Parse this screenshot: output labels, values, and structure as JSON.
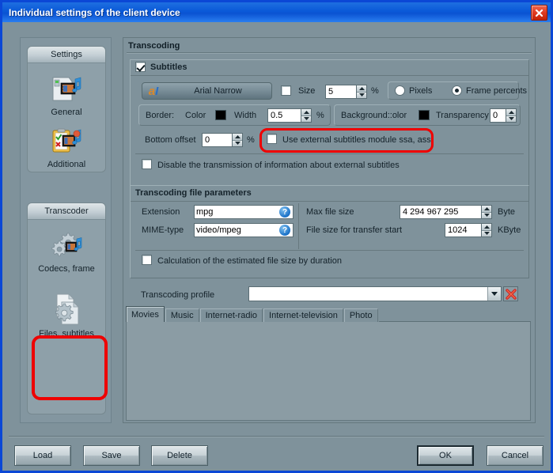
{
  "window": {
    "title": "Individual settings of the client device",
    "close_label": "×",
    "titlebar_color": "#0a59d8",
    "body_color": "#7f929b"
  },
  "sidebar": {
    "groups": [
      {
        "header": "Settings",
        "items": [
          {
            "label": "General",
            "icon": "folder-media-icon"
          },
          {
            "label": "Additional",
            "icon": "checklist-media-icon"
          }
        ]
      },
      {
        "header": "Transcoder",
        "items": [
          {
            "label": "Codecs, frame",
            "icon": "gears-media-icon"
          },
          {
            "label": "Files, subtitles",
            "icon": "file-gear-icon",
            "selected": true
          }
        ]
      }
    ]
  },
  "main": {
    "group_title": "Transcoding",
    "subtitles": {
      "title": "Subtitles",
      "enabled": true,
      "font_button": {
        "icon_text": "aI",
        "name": "Arial Narrow"
      },
      "size": {
        "label": "Size",
        "checked": false,
        "value": "5",
        "unit": "%"
      },
      "units": {
        "pixels": {
          "label": "Pixels",
          "selected": false
        },
        "frame_percents": {
          "label": "Frame percents",
          "selected": true
        }
      },
      "border": {
        "label": "Border:",
        "color_label": "Color",
        "color_value": "#000000",
        "width_label": "Width",
        "width_value": "0.5",
        "width_unit": "%"
      },
      "background": {
        "label": "Background::olor",
        "color_value": "#000000",
        "transparency_label": "Transparency",
        "transparency_value": "0"
      },
      "bottom_offset": {
        "label": "Bottom offset",
        "value": "0",
        "unit": "%"
      },
      "external_module": {
        "label": "Use external subtitles module ssa, ass",
        "checked": false,
        "highlight_color": "#ee0000"
      },
      "disable_transmission": {
        "label": "Disable the transmission of information about external subtitles",
        "checked": false
      }
    },
    "file_params": {
      "title": "Transcoding file parameters",
      "extension": {
        "label": "Extension",
        "value": "mpg",
        "help": "?"
      },
      "mime_type": {
        "label": "MIME-type",
        "value": "video/mpeg",
        "help": "?"
      },
      "max_file_size": {
        "label": "Max file size",
        "value": "4 294 967 295",
        "unit": "Byte"
      },
      "transfer_start": {
        "label": "File size for transfer start",
        "value": "1024",
        "unit": "KByte"
      },
      "calc_estimate": {
        "label": "Calculation of the estimated file size by duration",
        "checked": false
      },
      "profile": {
        "label": "Transcoding profile",
        "value": "",
        "delete_icon": "red-x-icon"
      }
    },
    "tabs": [
      {
        "label": "Movies",
        "active": true
      },
      {
        "label": "Music",
        "active": false
      },
      {
        "label": "Internet-radio",
        "active": false
      },
      {
        "label": "Internet-television",
        "active": false
      },
      {
        "label": "Photo",
        "active": false
      }
    ]
  },
  "footer": {
    "load": "Load",
    "save": "Save",
    "delete": "Delete",
    "ok": "OK",
    "cancel": "Cancel"
  }
}
